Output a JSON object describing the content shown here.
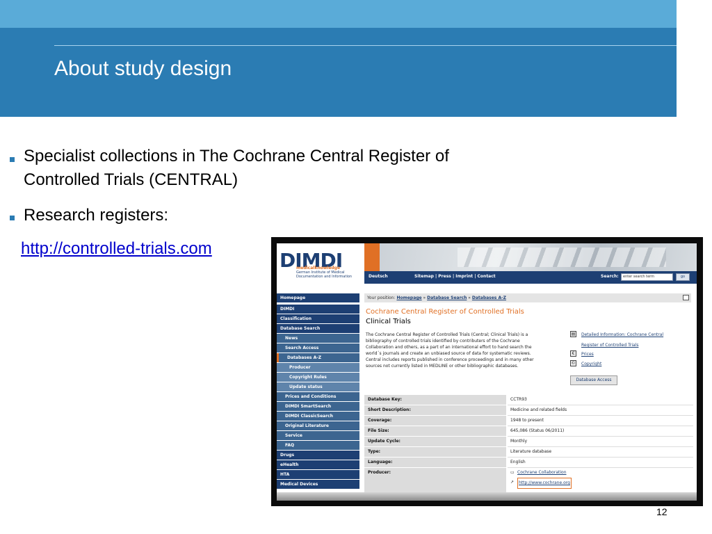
{
  "slide": {
    "title": "About study design",
    "bullets": [
      "Specialist collections in The Cochrane Central Register of",
      "Controlled Trials (CENTRAL)",
      "Research registers:"
    ],
    "link": "http://controlled-trials.com",
    "page_number": "12",
    "accent_color": "#2b7cb3"
  },
  "dimdi": {
    "logo": {
      "mark": "DIMDI",
      "sub1": "medicalknowledge",
      "sub2": "German Institute of Medical",
      "sub3": "Documentation and Information"
    },
    "topnav": {
      "lang": "Deutsch",
      "links": "Sitemap | Press | Imprint | Contact",
      "search_label": "Search:",
      "search_placeholder": "enter search term",
      "go": "go"
    },
    "breadcrumb": {
      "prefix": "Your position:",
      "items": [
        "Homepage",
        "Database Search",
        "Databases A-Z"
      ]
    },
    "nav": [
      {
        "label": "Homepage",
        "level": 1
      },
      {
        "label": "DIMDI",
        "level": 1
      },
      {
        "label": "Classification",
        "level": 1
      },
      {
        "label": "Database Search",
        "level": 1
      },
      {
        "label": "News",
        "level": 2
      },
      {
        "label": "Search Access",
        "level": 2
      },
      {
        "label": "Databases A-Z",
        "level": 2
      },
      {
        "label": "Producer",
        "level": 3
      },
      {
        "label": "Copyright Rules",
        "level": 3
      },
      {
        "label": "Update status",
        "level": 3
      },
      {
        "label": "Prices and Conditions",
        "level": 2
      },
      {
        "label": "DIMDI SmartSearch",
        "level": 2
      },
      {
        "label": "DIMDI ClassicSearch",
        "level": 2
      },
      {
        "label": "Original Literature",
        "level": 2
      },
      {
        "label": "Service",
        "level": 2
      },
      {
        "label": "FAQ",
        "level": 2
      },
      {
        "label": "Drugs",
        "level": 1
      },
      {
        "label": "eHealth",
        "level": 1
      },
      {
        "label": "HTA",
        "level": 1
      },
      {
        "label": "Medical Devices",
        "level": 1
      }
    ],
    "content": {
      "title": "Cochrane Central Register of Controlled Trials",
      "subtitle": "Clinical Trials",
      "description": [
        "The Cochrane Central Register of Controlled Trials (Central; Clinical Trials) is a",
        "bibliography of controlled trials identified by contributers of the Cochrane",
        "Collaboration and others, as a part of an international effort to hand search the",
        "world´s journals and create an unbiased source of data for systematic reviews.",
        "Central includes reports published in conference proceedings and in many other",
        "sources not currently listed in MEDLINE or other bibliographic databases."
      ],
      "links": {
        "detail_1": "Detailed Information: Cochrane Central",
        "detail_2": "Register of Controlled Trials",
        "prices": "Prices",
        "copyright": "Copyright"
      },
      "access_button": "Database Access"
    },
    "table": [
      {
        "key": "Database Key:",
        "value": "CCTR93"
      },
      {
        "key": "Short Description:",
        "value": "Medicine and related fields"
      },
      {
        "key": "Coverage:",
        "value": "1948 to present"
      },
      {
        "key": "File Size:",
        "value": "645,086 (Status 06/2011)"
      },
      {
        "key": "Update Cycle:",
        "value": "Monthly"
      },
      {
        "key": "Type:",
        "value": "Literature database"
      },
      {
        "key": "Language:",
        "value": "English"
      },
      {
        "key": "Producer:",
        "value": ""
      }
    ],
    "producer": {
      "name": "Cochrane Collaboration",
      "url": "http://www.cochrane.org"
    }
  }
}
